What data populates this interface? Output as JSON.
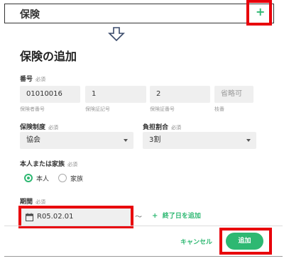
{
  "header": {
    "title": "保険",
    "add_icon": "plus-icon"
  },
  "dialog": {
    "title": "保険の追加",
    "required": "必須",
    "number": {
      "label": "番号",
      "fields": [
        {
          "value": "01010016",
          "hint": "保険者番号"
        },
        {
          "value": "1",
          "hint": "保険証記号"
        },
        {
          "value": "2",
          "hint": "保険証番号"
        },
        {
          "placeholder": "省略可",
          "hint": "枝番"
        }
      ]
    },
    "insurance_system": {
      "label": "保険制度",
      "value": "協会"
    },
    "burden_ratio": {
      "label": "負担割合",
      "value": "3割"
    },
    "person_or_family": {
      "label": "本人または家族",
      "options": [
        {
          "label": "本人",
          "selected": true
        },
        {
          "label": "家族",
          "selected": false
        }
      ]
    },
    "period": {
      "label": "期間",
      "start": "R05.02.01",
      "tilde": "～",
      "add_end_label": "終了日を追加"
    },
    "cancel_label": "キャンセル",
    "add_label": "追加"
  },
  "colors": {
    "accent": "#2eb872",
    "highlight": "#e8000b"
  }
}
